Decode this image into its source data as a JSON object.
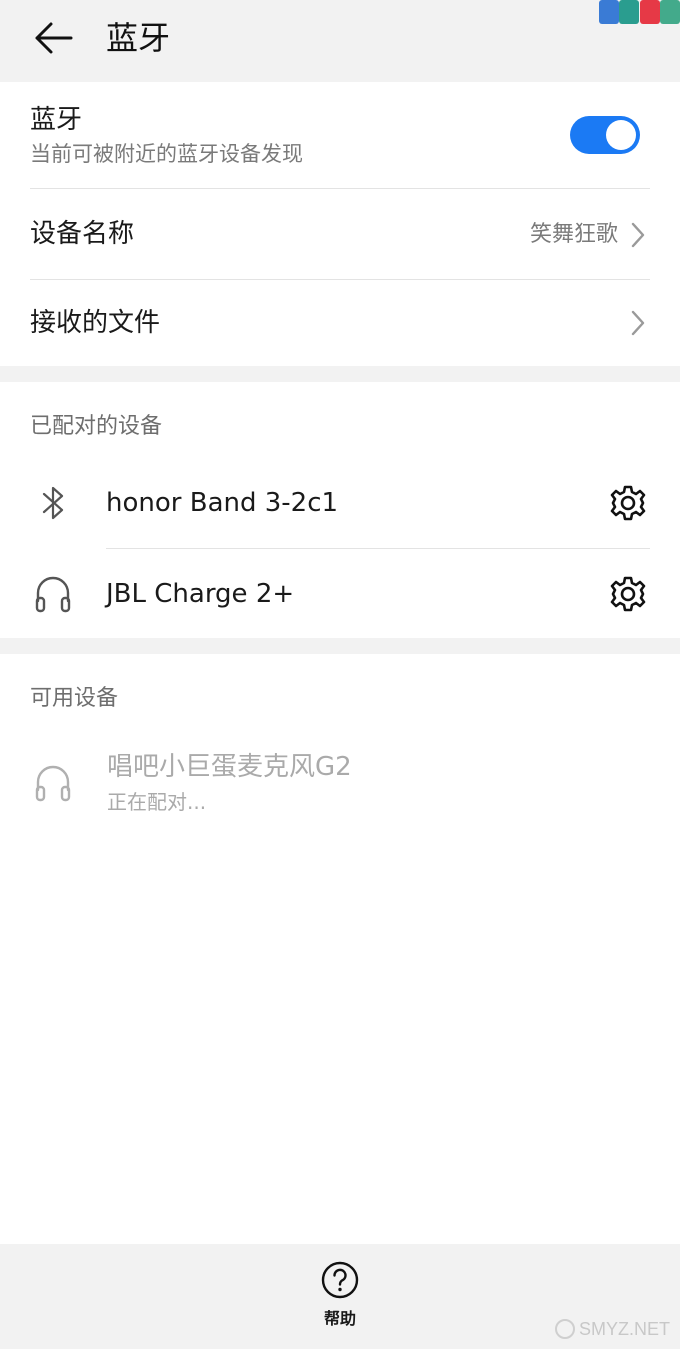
{
  "header": {
    "title": "蓝牙",
    "back_icon": "arrow-left-icon",
    "corner_art_colors": [
      "#3a7bd5",
      "#2a9d8f",
      "#e63946",
      "#43aa8b"
    ]
  },
  "bluetooth": {
    "title": "蓝牙",
    "subtitle": "当前可被附近的蓝牙设备发现",
    "enabled": true,
    "accent_color": "#1b7af4"
  },
  "device_name": {
    "label": "设备名称",
    "value": "笑舞狂歌"
  },
  "received_files": {
    "label": "接收的文件"
  },
  "paired": {
    "section_title": "已配对的设备",
    "devices": [
      {
        "name": "honor Band 3-2c1",
        "icon": "bluetooth-icon"
      },
      {
        "name": "JBL Charge 2+",
        "icon": "headset-icon"
      }
    ]
  },
  "available": {
    "section_title": "可用设备",
    "devices": [
      {
        "name": "唱吧小巨蛋麦克风G2",
        "status": "正在配对...",
        "icon": "headset-icon"
      }
    ]
  },
  "bottom": {
    "help_label": "帮助",
    "help_icon": "question-circle-icon"
  },
  "watermark": {
    "text": "SMYZ.NET"
  }
}
